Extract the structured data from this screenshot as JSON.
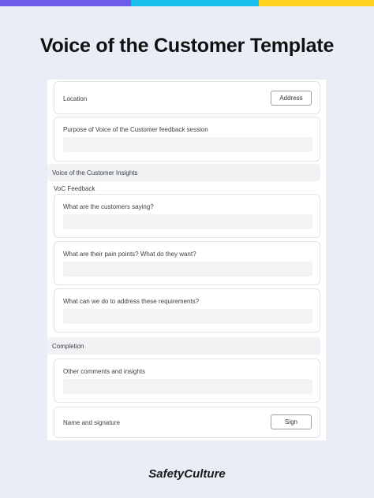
{
  "header": {
    "title": "Voice of the Customer Template"
  },
  "form": {
    "location_label": "Location",
    "address_button": "Address",
    "purpose_label": "Purpose of Voice of the Customer feedback session",
    "section_insights": "Voice of the Customer Insights",
    "subsection_feedback": "VoC Feedback",
    "q_saying": "What are the customers saying?",
    "q_pain_points": "What are their pain points? What do they want?",
    "q_address": "What can we do to address these requirements?",
    "section_completion": "Completion",
    "comments_label": "Other comments and insights",
    "signature_label": "Name and signature",
    "sign_button": "Sign"
  },
  "brand": {
    "name": "SafetyCulture"
  },
  "colors": {
    "bar_purple": "#6c5ce7",
    "bar_blue": "#19c0ee",
    "bar_yellow": "#ffd21f",
    "background": "#e9eef6"
  }
}
